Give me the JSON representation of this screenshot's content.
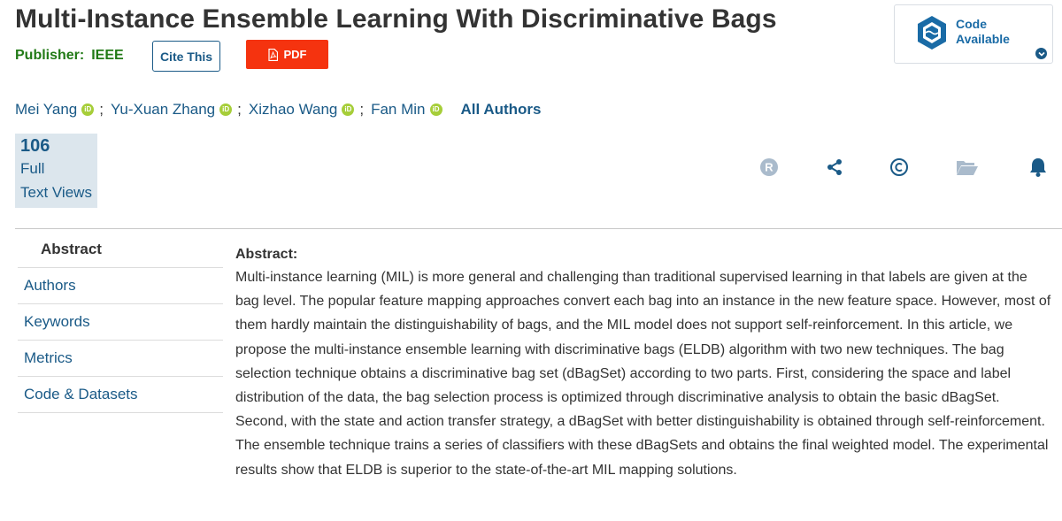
{
  "title": "Multi-Instance Ensemble Learning With Discriminative Bags",
  "publisher": {
    "label": "Publisher:",
    "value": "IEEE"
  },
  "buttons": {
    "cite": "Cite This",
    "pdf": "PDF"
  },
  "code_badge": {
    "line1": "Code",
    "line2": "Available"
  },
  "authors": [
    {
      "name": "Mei Yang",
      "sep": ";"
    },
    {
      "name": "Yu-Xuan Zhang",
      "sep": ";"
    },
    {
      "name": "Xizhao Wang",
      "sep": ";"
    },
    {
      "name": "Fan Min",
      "sep": ""
    }
  ],
  "all_authors": "All Authors",
  "orcid_text": "iD",
  "metrics": {
    "count": "106",
    "line1": "Full",
    "line2": "Text Views"
  },
  "icons": [
    "rights-icon",
    "share-icon",
    "copyright-icon",
    "folder-icon",
    "bell-icon"
  ],
  "sidenav": [
    "Abstract",
    "Authors",
    "Keywords",
    "Metrics",
    "Code & Datasets"
  ],
  "abstract": {
    "heading": "Abstract:",
    "body": "Multi-instance learning (MIL) is more general and challenging than traditional supervised learning in that labels are given at the bag level. The popular feature mapping approaches convert each bag into an instance in the new feature space. However, most of them hardly maintain the distinguishability of bags, and the MIL model does not support self-reinforcement. In this article, we propose the multi-instance ensemble learning with discriminative bags (ELDB) algorithm with two new techniques. The bag selection technique obtains a discriminative bag set (dBagSet) according to two parts. First, considering the space and label distribution of the data, the bag selection process is optimized through discriminative analysis to obtain the basic dBagSet. Second, with the state and action transfer strategy, a dBagSet with better distinguishability is obtained through self-reinforcement. The ensemble technique trains a series of classifiers with these dBagSets and obtains the final weighted model. The experimental results show that ELDB is superior to the state-of-the-art MIL mapping solutions."
  },
  "colors": {
    "link": "#1a5a87",
    "publisher": "#217a16",
    "pdf": "#f5330f",
    "orcid": "#a6ce39",
    "icon_gray": "#aabbcc",
    "icon_blue": "#1a5a87"
  }
}
